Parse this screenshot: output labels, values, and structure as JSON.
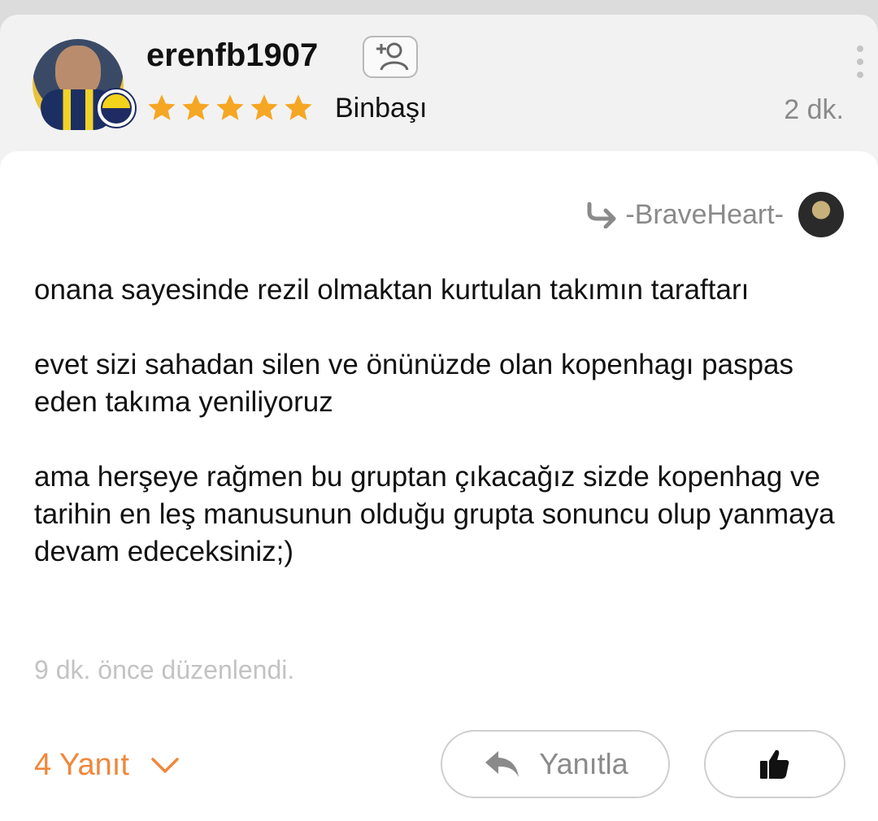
{
  "header": {
    "username": "erenfb1907",
    "rank": "Binbaşı",
    "stars": 5,
    "time": "2 dk."
  },
  "reply_to": {
    "name": "-BraveHeart-"
  },
  "comment": {
    "paragraphs": [
      "onana sayesinde rezil olmaktan kurtulan takımın taraftarı",
      "evet sizi sahadan silen ve önünüzde olan kopenhagı paspas eden takıma yeniliyoruz",
      "ama herşeye rağmen bu gruptan çıkacağız sizde kopenhag ve tarihin en leş manusunun olduğu grupta sonuncu olup yanmaya devam edeceksiniz;)"
    ],
    "edited_label": "9 dk.  önce düzenlendi."
  },
  "footer": {
    "replies_label": "4 Yanıt",
    "reply_button_label": "Yanıtla"
  },
  "colors": {
    "accent": "#f0873a",
    "star": "#f5a623",
    "muted": "#8a8a8a"
  },
  "icons": [
    "add-user-icon",
    "star-icon",
    "more-vertical-icon",
    "reply-arrow-icon",
    "chevron-down-icon",
    "reply-icon",
    "thumbs-up-icon"
  ]
}
